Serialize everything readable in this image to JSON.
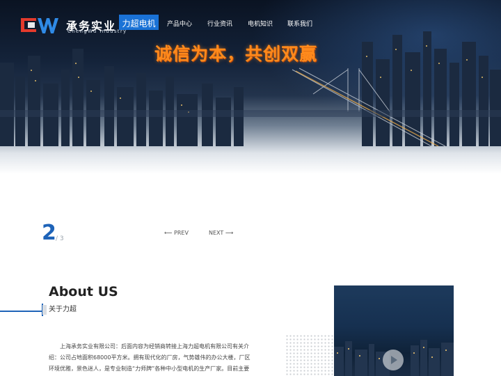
{
  "header": {
    "brand_cn": "承务实业",
    "brand_en": "ChengWu Industry",
    "brand_tag": "力超电机",
    "nav": [
      "产品中心",
      "行业资讯",
      "电机知识",
      "联系我们"
    ]
  },
  "hero": {
    "slogan": "诚信为本，共创双赢"
  },
  "slider": {
    "current": "2",
    "total": "/ 3",
    "prev_label": "PREV",
    "next_label": "NEXT"
  },
  "about": {
    "title": "About US",
    "subtitle": "关于力超",
    "text": "上海承务实业有限公司：后面内容为经销商转接上海力超电机有限公司有关介绍：公司占地面积68000平方米。拥有现代化的厂房，气势雄伟的办公大楼，厂区环境优雅，景色迷人，是专业制造“力师牌”各种中小型电机的生产厂家。目前主要"
  },
  "colors": {
    "accent": "#1e63b8",
    "brand_tag_bg": "#1a72d6",
    "slogan": "#ff8a1c"
  },
  "icons": {
    "logo": "cw-logo-mark",
    "prev": "arrow-left-icon",
    "next": "arrow-right-icon",
    "video": "play-icon"
  }
}
